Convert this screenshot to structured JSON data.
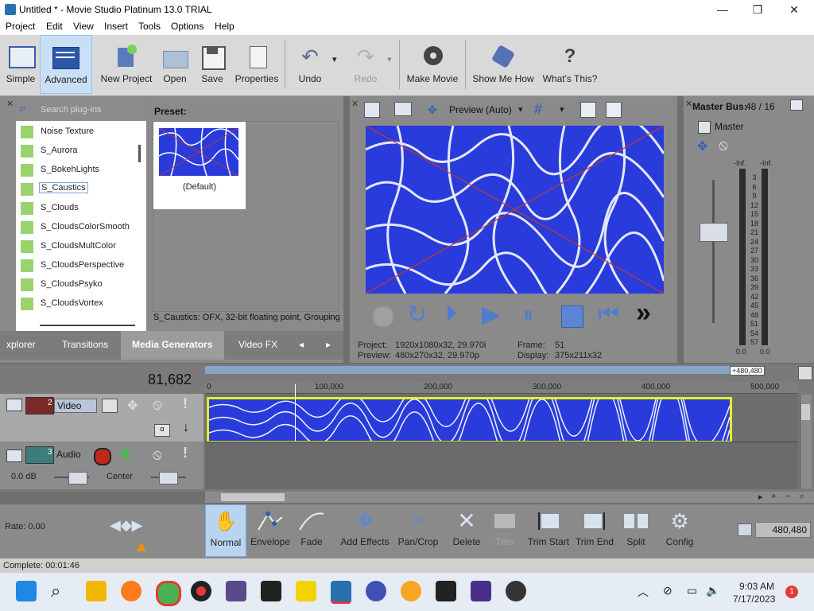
{
  "window": {
    "title": "Untitled * - Movie Studio Platinum 13.0 TRIAL",
    "minimize": "—",
    "maximize": "❐",
    "close": "✕"
  },
  "menu": [
    "Project",
    "Edit",
    "View",
    "Insert",
    "Tools",
    "Options",
    "Help"
  ],
  "toolbar": {
    "simple": "Simple",
    "advanced": "Advanced",
    "new_project": "New Project",
    "open": "Open",
    "save": "Save",
    "properties": "Properties",
    "undo": "Undo",
    "redo": "Redo",
    "make_movie": "Make Movie",
    "show_me_how": "Show Me How",
    "whats_this": "What's This?"
  },
  "plugins": {
    "search_placeholder": "Search plug-ins",
    "items": [
      "Noise Texture",
      "S_Aurora",
      "S_BokehLights",
      "S_Caustics",
      "S_Clouds",
      "S_CloudsColorSmooth",
      "S_CloudsMultColor",
      "S_CloudsPerspective",
      "S_CloudsPsyko",
      "S_CloudsVortex"
    ],
    "selected": "S_Caustics",
    "preset_label": "Preset:",
    "preset_name": "(Default)",
    "description": "S_Caustics: OFX, 32-bit floating point, Grouping"
  },
  "tabs": [
    "xplorer",
    "Transitions",
    "Media Generators",
    "Video FX"
  ],
  "active_tab": "Media Generators",
  "preview": {
    "mode": "Preview (Auto)",
    "project_label": "Project:",
    "project_value": "1920x1080x32, 29.970i",
    "preview_label": "Preview:",
    "preview_value": "480x270x32, 29.970p",
    "frame_label": "Frame:",
    "frame_value": "51",
    "display_label": "Display:",
    "display_value": "375x211x32"
  },
  "master": {
    "title": "Master Bus:",
    "value": "48 / 16",
    "name": "Master",
    "inf_left": "-Inf.",
    "inf_right": "-Inf.",
    "scale": [
      "3",
      "6",
      "9",
      "12",
      "15",
      "18",
      "21",
      "24",
      "27",
      "30",
      "33",
      "36",
      "39",
      "42",
      "45",
      "48",
      "51",
      "54",
      "57"
    ],
    "bottom_left": "0.0",
    "bottom_right": "0.0"
  },
  "timeline": {
    "time": "81,682",
    "end_marker": "+480,480",
    "ruler": [
      "0",
      "100,000",
      "200,000",
      "300,000",
      "400,000",
      "500,000"
    ],
    "video_track_num": "2",
    "video_track_name": "Video",
    "audio_track_num": "3",
    "audio_track_name": "Audio",
    "audio_db": "0.0 dB",
    "audio_pan": "Center"
  },
  "bottom": {
    "rate": "Rate: 0.00",
    "normal": "Normal",
    "envelope": "Envelope",
    "fade": "Fade",
    "add_effects": "Add Effects",
    "pan_crop": "Pan/Crop",
    "delete": "Delete",
    "trim": "Trim",
    "trim_start": "Trim Start",
    "trim_end": "Trim End",
    "split": "Split",
    "config": "Config",
    "position": "480,480"
  },
  "status": "Complete: 00:01:46",
  "taskbar": {
    "time": "9:03 AM",
    "date": "7/17/2023",
    "notif": "1"
  },
  "colors": {
    "accent_blue": "#2a3bdc",
    "clip_border": "#e7f21e",
    "taskbar_bg": "#e6ecf3"
  }
}
